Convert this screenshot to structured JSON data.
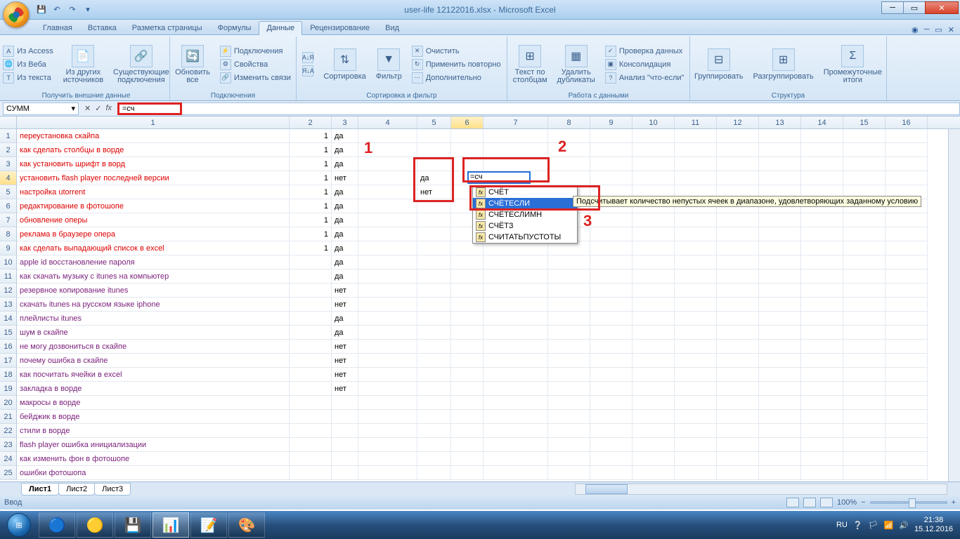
{
  "title": "user-life 12122016.xlsx - Microsoft Excel",
  "tabs": [
    "Главная",
    "Вставка",
    "Разметка страницы",
    "Формулы",
    "Данные",
    "Рецензирование",
    "Вид"
  ],
  "active_tab": 4,
  "ribbon": {
    "g1": {
      "label": "Получить внешние данные",
      "access": "Из Access",
      "web": "Из Веба",
      "text": "Из текста",
      "other": "Из других источников",
      "existing": "Существующие подключения"
    },
    "g2": {
      "label": "Подключения",
      "refresh": "Обновить все",
      "conn": "Подключения",
      "prop": "Свойства",
      "links": "Изменить связи"
    },
    "g3": {
      "label": "Сортировка и фильтр",
      "az": "А↓Я",
      "za": "Я↓А",
      "sort": "Сортировка",
      "filter": "Фильтр",
      "clear": "Очистить",
      "reapply": "Применить повторно",
      "adv": "Дополнительно"
    },
    "g4": {
      "label": "Работа с данными",
      "cols": "Текст по столбцам",
      "dup": "Удалить дубликаты",
      "valid": "Проверка данных",
      "cons": "Консолидация",
      "whatif": "Анализ \"что-если\""
    },
    "g5": {
      "label": "Структура",
      "group": "Группировать",
      "ungroup": "Разгруппировать",
      "subtotal": "Промежуточные итоги"
    }
  },
  "namebox": "СУММ",
  "formula": "=сч",
  "columns": [
    388,
    60,
    38,
    84,
    48,
    46,
    92,
    60,
    60,
    60,
    60,
    60,
    60,
    60,
    60,
    60
  ],
  "rows": [
    {
      "a": "переустановка скайпа",
      "b": 1,
      "c": "да",
      "cls": "c-red"
    },
    {
      "a": "как сделать столбцы в ворде",
      "b": 1,
      "c": "да",
      "cls": "c-red"
    },
    {
      "a": "как установить шрифт в ворд",
      "b": 1,
      "c": "да",
      "cls": "c-red"
    },
    {
      "a": "установить flash player последней версии",
      "b": 1,
      "c": "нет",
      "cls": "c-red",
      "e": "да"
    },
    {
      "a": "настройка utorrent",
      "b": 1,
      "c": "да",
      "cls": "c-red",
      "e": "нет"
    },
    {
      "a": "редактирование в фотошопе",
      "b": 1,
      "c": "да",
      "cls": "c-red"
    },
    {
      "a": "обновление оперы",
      "b": 1,
      "c": "да",
      "cls": "c-red"
    },
    {
      "a": "реклама в браузере опера",
      "b": 1,
      "c": "да",
      "cls": "c-red"
    },
    {
      "a": "как сделать выпадающий список в excel",
      "b": 1,
      "c": "да",
      "cls": "c-red"
    },
    {
      "a": "apple id восстановление пароля",
      "b": "",
      "c": "да",
      "cls": "c-purple"
    },
    {
      "a": "как скачать музыку с itunes на компьютер",
      "b": "",
      "c": "да",
      "cls": "c-purple"
    },
    {
      "a": "резервное копирование itunes",
      "b": "",
      "c": "нет",
      "cls": "c-purple"
    },
    {
      "a": "скачать itunes на русском языке iphone",
      "b": "",
      "c": "нет",
      "cls": "c-purple"
    },
    {
      "a": "плейлисты itunes",
      "b": "",
      "c": "да",
      "cls": "c-purple"
    },
    {
      "a": "шум в скайпе",
      "b": "",
      "c": "да",
      "cls": "c-purple"
    },
    {
      "a": "не могу дозвониться в скайпе",
      "b": "",
      "c": "нет",
      "cls": "c-purple"
    },
    {
      "a": "почему ошибка в скайпе",
      "b": "",
      "c": "нет",
      "cls": "c-purple"
    },
    {
      "a": "как посчитать ячейки в excel",
      "b": "",
      "c": "нет",
      "cls": "c-purple"
    },
    {
      "a": "закладка в ворде",
      "b": "",
      "c": "нет",
      "cls": "c-purple"
    },
    {
      "a": "макросы в ворде",
      "b": "",
      "c": "",
      "cls": "c-purple"
    },
    {
      "a": "бейджик в ворде",
      "b": "",
      "c": "",
      "cls": "c-purple"
    },
    {
      "a": "стили в ворде",
      "b": "",
      "c": "",
      "cls": "c-purple"
    },
    {
      "a": "flash player ошибка инициализации",
      "b": "",
      "c": "",
      "cls": "c-purple"
    },
    {
      "a": "как изменить фон в фотошопе",
      "b": "",
      "c": "",
      "cls": "c-purple"
    },
    {
      "a": "ошибки фотошопа",
      "b": "",
      "c": "",
      "cls": "c-purple"
    }
  ],
  "cell_edit": "=сч",
  "autocomplete": [
    "СЧЁТ",
    "СЧЁТЕСЛИ",
    "СЧЁТЕСЛИМН",
    "СЧЁТЗ",
    "СЧИТАТЬПУСТОТЫ"
  ],
  "ac_selected": 1,
  "ac_tooltip": "Подсчитывает количество непустых ячеек в диапазоне, удовлетворяющих заданному условию",
  "sheets": [
    "Лист1",
    "Лист2",
    "Лист3"
  ],
  "status": "Ввод",
  "zoom": "100%",
  "anno": {
    "n1": "1",
    "n2": "2",
    "n3": "3"
  },
  "tray": {
    "lang": "RU",
    "time": "21:38",
    "date": "15.12.2016"
  }
}
